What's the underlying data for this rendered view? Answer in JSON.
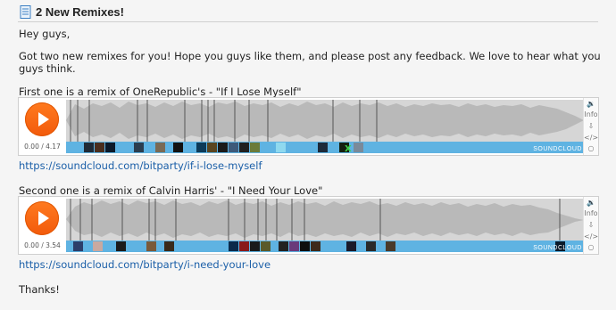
{
  "post": {
    "title": "2 New Remixes!",
    "greeting": "Hey guys,",
    "intro_line1": "Got two new remixes for you! Hope you guys like them, and please post any feedback. We love to hear what you",
    "intro_line2": "guys think.",
    "sign_off": "Thanks!"
  },
  "tracks": [
    {
      "caption": "First one is a remix of OneRepublic's - \"If I Lose Myself\"",
      "time": "0.00 / 4.17",
      "link": "https://soundcloud.com/bitparty/if-i-lose-myself"
    },
    {
      "caption": "Second one is a remix of Calvin Harris' - \"I Need Your Love\"",
      "time": "0.00 / 3.54",
      "link": "https://soundcloud.com/bitparty/i-need-your-love"
    }
  ],
  "player": {
    "info_label": "Info",
    "embed_label": "</>",
    "volume_icon": "volume-icon",
    "download_icon": "download-icon",
    "brand_label": "SOUNDCLOUD",
    "colors": {
      "play": "#f25a0b",
      "waveform": "#c4c4c4",
      "comment_bar": "#5fb3e2"
    }
  }
}
